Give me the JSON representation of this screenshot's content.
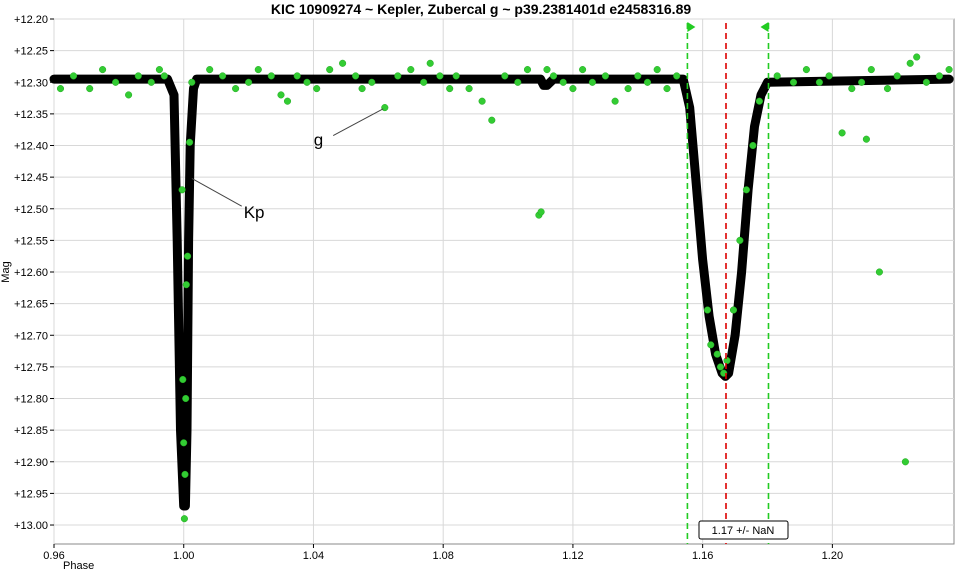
{
  "chart_data": {
    "type": "scatter",
    "title": "KIC 10909274 ~ Kepler, Zubercal g ~ p39.2381401d e2458316.89",
    "xlabel": "Phase",
    "ylabel": "Mag",
    "xlim": [
      0.96,
      1.2375
    ],
    "ylim": [
      13.03,
      12.2
    ],
    "y_reversed": true,
    "y_tick_prefix": "+",
    "x_ticks": [
      0.96,
      1.0,
      1.04,
      1.08,
      1.12,
      1.16,
      1.2
    ],
    "y_ticks": [
      12.2,
      12.25,
      12.3,
      12.35,
      12.4,
      12.45,
      12.5,
      12.55,
      12.6,
      12.65,
      12.7,
      12.75,
      12.8,
      12.85,
      12.9,
      12.95,
      13.0
    ],
    "grid": true,
    "colors": {
      "kp": "#000000",
      "g": "#33cc33",
      "g_edge": "#22aa22",
      "marker_green": "#22cc22",
      "marker_red": "#dd0000",
      "grid": "#d8d8d8"
    },
    "series": [
      {
        "name": "Kp",
        "style": "dense-black-curve",
        "baseline": 12.295,
        "x": [
          0.96,
          0.995,
          0.997,
          0.998,
          0.999,
          1.0,
          1.0005,
          1.001,
          1.0015,
          1.002,
          1.003,
          1.004,
          1.09,
          1.11,
          1.111,
          1.112,
          1.114,
          1.154,
          1.156,
          1.158,
          1.16,
          1.162,
          1.164,
          1.166,
          1.167,
          1.168,
          1.17,
          1.172,
          1.174,
          1.176,
          1.178,
          1.18,
          1.236
        ],
        "y": [
          12.295,
          12.295,
          12.32,
          12.55,
          12.85,
          12.97,
          12.97,
          12.85,
          12.55,
          12.4,
          12.31,
          12.295,
          12.295,
          12.295,
          12.305,
          12.305,
          12.295,
          12.295,
          12.34,
          12.46,
          12.58,
          12.67,
          12.73,
          12.76,
          12.765,
          12.76,
          12.7,
          12.6,
          12.47,
          12.37,
          12.32,
          12.3,
          12.295
        ]
      },
      {
        "name": "g",
        "style": "green-dots",
        "x": [
          0.962,
          0.966,
          0.971,
          0.975,
          0.979,
          0.983,
          0.986,
          0.99,
          0.9925,
          0.994,
          0.9995,
          0.9997,
          1.0,
          1.0002,
          1.0004,
          1.0006,
          1.0008,
          1.0012,
          1.0018,
          1.0025,
          1.008,
          1.012,
          1.016,
          1.02,
          1.023,
          1.027,
          1.03,
          1.032,
          1.035,
          1.038,
          1.041,
          1.045,
          1.049,
          1.053,
          1.055,
          1.058,
          1.062,
          1.066,
          1.07,
          1.074,
          1.076,
          1.079,
          1.082,
          1.084,
          1.088,
          1.092,
          1.095,
          1.099,
          1.103,
          1.106,
          1.1095,
          1.1102,
          1.112,
          1.114,
          1.117,
          1.12,
          1.123,
          1.126,
          1.13,
          1.133,
          1.137,
          1.14,
          1.143,
          1.146,
          1.149,
          1.152,
          1.1615,
          1.1625,
          1.1645,
          1.1655,
          1.1665,
          1.1675,
          1.1695,
          1.1715,
          1.1735,
          1.1755,
          1.1775,
          1.183,
          1.188,
          1.192,
          1.196,
          1.199,
          1.203,
          1.206,
          1.209,
          1.2105,
          1.212,
          1.2145,
          1.217,
          1.22,
          1.2225,
          1.224,
          1.226,
          1.229,
          1.233,
          1.236
        ],
        "y": [
          12.31,
          12.29,
          12.31,
          12.28,
          12.3,
          12.32,
          12.29,
          12.3,
          12.28,
          12.29,
          12.47,
          12.77,
          12.87,
          12.99,
          12.92,
          12.8,
          12.62,
          12.575,
          12.395,
          12.3,
          12.28,
          12.29,
          12.31,
          12.3,
          12.28,
          12.29,
          12.32,
          12.33,
          12.29,
          12.3,
          12.31,
          12.28,
          12.27,
          12.29,
          12.31,
          12.3,
          12.34,
          12.29,
          12.28,
          12.3,
          12.27,
          12.29,
          12.31,
          12.29,
          12.31,
          12.33,
          12.36,
          12.29,
          12.3,
          12.28,
          12.51,
          12.505,
          12.28,
          12.29,
          12.3,
          12.31,
          12.28,
          12.3,
          12.29,
          12.33,
          12.31,
          12.29,
          12.3,
          12.28,
          12.31,
          12.29,
          12.66,
          12.715,
          12.73,
          12.75,
          12.76,
          12.74,
          12.66,
          12.55,
          12.47,
          12.4,
          12.33,
          12.29,
          12.3,
          12.28,
          12.3,
          12.29,
          12.38,
          12.31,
          12.3,
          12.39,
          12.28,
          12.6,
          12.31,
          12.29,
          12.9,
          12.27,
          12.26,
          12.3,
          12.29,
          12.28
        ]
      }
    ],
    "annotations": [
      {
        "text": "g",
        "x": 1.043,
        "y": 12.4,
        "arrow_to_x": 1.0615,
        "arrow_to_y": 12.342
      },
      {
        "text": "Kp",
        "x": 1.0185,
        "y": 12.515,
        "arrow_to_x": 1.0025,
        "arrow_to_y": 12.452
      }
    ],
    "markers": [
      {
        "type": "vline",
        "x": 1.1553,
        "color": "green",
        "style": "dashed",
        "triangle": "right"
      },
      {
        "type": "vline",
        "x": 1.1672,
        "color": "red",
        "style": "dashed"
      },
      {
        "type": "vline",
        "x": 1.1803,
        "color": "green",
        "style": "dashed",
        "triangle": "left"
      }
    ],
    "readout": "1.17 +/- NaN"
  }
}
